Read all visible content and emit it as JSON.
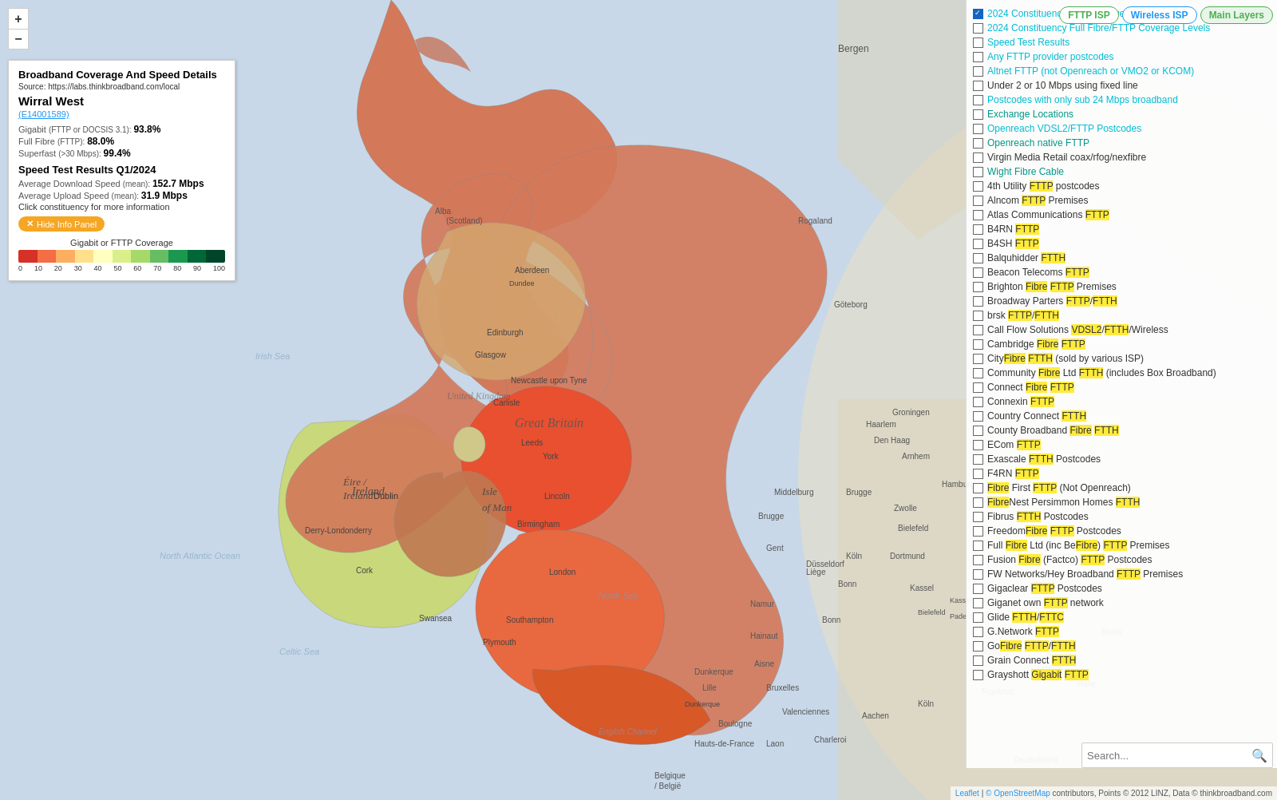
{
  "tabs": {
    "fttp": "FTTP ISP",
    "wireless": "Wireless ISP",
    "main_layers": "Main Layers"
  },
  "zoom": {
    "in": "+",
    "out": "−"
  },
  "info_panel": {
    "title": "Broadband Coverage And Speed Details",
    "source": "Source: https://labs.thinkbroadband.com/local",
    "constituency": "Wirral West",
    "link": "(E14001589)",
    "stats": [
      {
        "label": "Gigabit",
        "sub": "(FTTP or DOCSIS 3.1):",
        "value": "93.8%"
      },
      {
        "label": "Full Fibre",
        "sub": "(FTTP):",
        "value": "88.0%"
      },
      {
        "label": "Superfast",
        "sub": "(>30 Mbps):",
        "value": "99.4%"
      }
    ],
    "speed_title": "Speed Test Results Q1/2024",
    "download": "Average Download Speed",
    "download_sub": "(mean):",
    "download_val": "152.7 Mbps",
    "upload": "Average Upload Speed",
    "upload_sub": "(mean):",
    "upload_val": "31.9 Mbps",
    "click_note": "Click constituency for more information",
    "hide_btn": "Hide Info Panel",
    "legend_title": "Gigabit or FTTP Coverage",
    "legend_labels": [
      "0",
      "10",
      "20",
      "30",
      "40",
      "50",
      "60",
      "70",
      "80",
      "90",
      "100"
    ]
  },
  "layers": [
    {
      "id": "gigabit_coverage",
      "label": "2024 Constituency Gigabit Coverage Levels",
      "color": "cyan",
      "checked": true
    },
    {
      "id": "fttp_coverage",
      "label": "2024 Constituency Full Fibre/FTTP Coverage Levels",
      "color": "cyan",
      "checked": false
    },
    {
      "id": "speed_test",
      "label": "Speed Test Results",
      "color": "cyan",
      "checked": false
    },
    {
      "id": "any_fttp",
      "label": "Any FTTP provider postcodes",
      "color": "cyan",
      "checked": false
    },
    {
      "id": "altnet_fttp",
      "label": "Altnet FTTP (not Openreach or VMO2 or KCOM)",
      "color": "cyan",
      "checked": false
    },
    {
      "id": "under2",
      "label": "Under 2 or 10 Mbps using fixed line",
      "color": "cyan",
      "checked": false
    },
    {
      "id": "sub24",
      "label": "Postcodes with only sub 24 Mbps broadband",
      "color": "cyan",
      "checked": false
    },
    {
      "id": "exchange",
      "label": "Exchange Locations",
      "color": "teal",
      "checked": false
    },
    {
      "id": "or_vdsl2",
      "label": "Openreach VDSL2/FTTP Postcodes",
      "color": "cyan",
      "checked": false
    },
    {
      "id": "or_native",
      "label": "Openreach native FTTP",
      "color": "teal",
      "checked": false
    },
    {
      "id": "virgin",
      "label": "Virgin Media Retail coax/rfog/nexfibre",
      "color": "cyan",
      "checked": false
    },
    {
      "id": "wight_fibre",
      "label": "Wight Fibre Cable",
      "color": "teal",
      "checked": false
    },
    {
      "id": "4th_utility",
      "label": "4th Utility FTTP postcodes",
      "color": "yellow",
      "checked": false
    },
    {
      "id": "alncom",
      "label": "Alncom FTTP Premises",
      "color": "yellow",
      "checked": false
    },
    {
      "id": "atlas",
      "label": "Atlas Communications FTTP",
      "color": "yellow",
      "checked": false
    },
    {
      "id": "b4rn",
      "label": "B4RN FTTP",
      "color": "yellow",
      "checked": false
    },
    {
      "id": "b4sh",
      "label": "B4SH FTTP",
      "color": "yellow",
      "checked": false
    },
    {
      "id": "balquhidder",
      "label": "Balquhidder FTTH",
      "color": "yellow",
      "checked": false
    },
    {
      "id": "beacon",
      "label": "Beacon Telecoms FTTP",
      "color": "yellow",
      "checked": false
    },
    {
      "id": "brighton",
      "label": "Brighton Fibre FTTP Premises",
      "color": "yellow",
      "checked": false
    },
    {
      "id": "broadway",
      "label": "Broadway Parters FTTP/FTTH",
      "color": "yellow",
      "checked": false
    },
    {
      "id": "brsk",
      "label": "brsk FTTP/FTTH",
      "color": "yellow",
      "checked": false
    },
    {
      "id": "call_flow",
      "label": "Call Flow Solutions VDSL2/FTTH/Wireless",
      "color": "yellow",
      "checked": false
    },
    {
      "id": "cambridge",
      "label": "Cambridge Fibre FTTP",
      "color": "yellow",
      "checked": false
    },
    {
      "id": "cityfibre",
      "label": "CityFibre FTTH (sold by various ISP)",
      "color": "yellow",
      "checked": false
    },
    {
      "id": "community",
      "label": "Community Fibre Ltd FTTH (includes Box Broadband)",
      "color": "yellow",
      "checked": false
    },
    {
      "id": "connect_fibre",
      "label": "Connect Fibre FTTP",
      "color": "yellow",
      "checked": false
    },
    {
      "id": "connexin",
      "label": "Connexin FTTP",
      "color": "yellow",
      "checked": false
    },
    {
      "id": "country_connect",
      "label": "Country Connect FTTH",
      "color": "yellow",
      "checked": false
    },
    {
      "id": "county_broadband",
      "label": "County Broadband Fibre FTTH",
      "color": "yellow",
      "checked": false
    },
    {
      "id": "ecom",
      "label": "ECom FTTP",
      "color": "yellow",
      "checked": false
    },
    {
      "id": "exascale",
      "label": "Exascale FTTH Postcodes",
      "color": "yellow",
      "checked": false
    },
    {
      "id": "f4rn",
      "label": "F4RN FTTP",
      "color": "yellow",
      "checked": false
    },
    {
      "id": "fibre_first",
      "label": "Fibre First FTTP (Not Openreach)",
      "color": "yellow",
      "checked": false
    },
    {
      "id": "fibrenest",
      "label": "FibreNest Persimmon Homes FTTH",
      "color": "yellow",
      "checked": false
    },
    {
      "id": "fibrus",
      "label": "Fibrus FTTH Postcodes",
      "color": "yellow",
      "checked": false
    },
    {
      "id": "freedomfibre",
      "label": "FreedomFibre FTTP Postcodes",
      "color": "yellow",
      "checked": false
    },
    {
      "id": "full_fibre",
      "label": "Full Fibre Ltd (inc BeFibre) FTTP Premises",
      "color": "yellow",
      "checked": false
    },
    {
      "id": "fusion_fibre",
      "label": "Fusion Fibre (Factco) FTTP Postcodes",
      "color": "yellow",
      "checked": false
    },
    {
      "id": "fw_networks",
      "label": "FW Networks/Hey Broadband FTTP Premises",
      "color": "yellow",
      "checked": false
    },
    {
      "id": "gigaclear",
      "label": "Gigaclear FTTP Postcodes",
      "color": "yellow",
      "checked": false
    },
    {
      "id": "giganet",
      "label": "Giganet own FTTP network",
      "color": "yellow",
      "checked": false
    },
    {
      "id": "glide",
      "label": "Glide FTTH/FTTC",
      "color": "yellow",
      "checked": false
    },
    {
      "id": "gnetwork",
      "label": "G.Network FTTP",
      "color": "yellow",
      "checked": false
    },
    {
      "id": "gofibre",
      "label": "GoFibre FTTP/FTTH",
      "color": "yellow",
      "checked": false
    },
    {
      "id": "grain",
      "label": "Grain Connect FTTH",
      "color": "yellow",
      "checked": false
    },
    {
      "id": "grayshott",
      "label": "Grayshott Gigabit FTTP",
      "color": "yellow",
      "checked": false
    }
  ],
  "search": {
    "placeholder": "Search..."
  },
  "footer": {
    "leaflet": "Leaflet",
    "osm": "© OpenStreetMap",
    "rest": " contributors, Points © 2012 LINZ, Data © thinkbroadband.com"
  },
  "map_labels": {
    "isle_of_man": "Isle of Man",
    "ireland": "Ireland",
    "great_britain": "Great Britain",
    "bergen": "Bergen"
  },
  "colors": {
    "accent_blue": "#1565C0",
    "accent_cyan": "#00BCD4",
    "accent_teal": "#009688",
    "accent_yellow": "#FFEB3B",
    "legend_colors": [
      "#d73027",
      "#f46d43",
      "#fdae61",
      "#fee08b",
      "#ffffbf",
      "#d9ef8b",
      "#a6d96a",
      "#66bd63",
      "#1a9850",
      "#006837",
      "#004529"
    ]
  }
}
